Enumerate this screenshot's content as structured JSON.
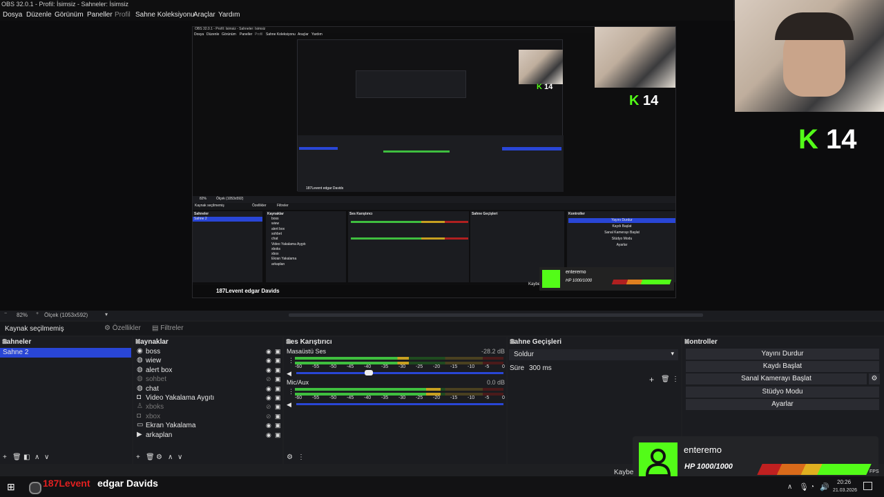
{
  "window": {
    "title": "OBS 32.0.1 - Profil: İsimsiz - Sahneler: İsimsiz"
  },
  "menu": [
    "Dosya",
    "Düzenle",
    "Görünüm",
    "Paneller",
    "Profil",
    "Sahne Koleksiyonu",
    "Araçlar",
    "Yardım"
  ],
  "nested_preview": {
    "title": "OBS 32.0.1 - Profil: İsimsiz - Sahneler: İsimsiz",
    "menu": [
      "Dosya",
      "Düzenle",
      "Görünüm",
      "Paneller",
      "Profil",
      "Sahne Koleksiyonu",
      "Araçlar",
      "Yardım"
    ],
    "status": "Kaynak seçilmemiş",
    "props": "Özellikler",
    "filters": "Filtreler",
    "zoom": "82%",
    "scale": "Ölçek (1053x592)",
    "scenes_title": "Sahneler",
    "scene": "Sahne 2",
    "sources_title": "Kaynaklar",
    "sources": [
      "boss",
      "wiew",
      "alert box",
      "sohbet",
      "chat",
      "Video Yakalama Aygıtı",
      "xboks",
      "xbox",
      "Ekran Yakalama",
      "arkaplan"
    ],
    "mixer_title": "Ses Karıştırıcı",
    "transitions_title": "Sahne Geçişleri",
    "controls_title": "Kontroller",
    "controls": [
      "Yayını Durdur",
      "Kaydı Başlat",
      "Sanal Kamerayı Başlat",
      "Stüdyo Modu",
      "Ayarlar"
    ],
    "bottom_text": "187Levent  edgar Davids",
    "kayb": "Kaybe",
    "k14": "14",
    "alert_name": "enteremo",
    "alert_hp": "HP 1000/1000"
  },
  "overlay": {
    "k14_label": "14",
    "alert_name": "enteremo",
    "alert_hp": "HP 1000/1000",
    "fps": "FPS",
    "kayb": "Kaybe"
  },
  "preview_bar": {
    "zoom": "82%",
    "scale": "Ölçek (1053x592)"
  },
  "props_bar": {
    "status": "Kaynak seçilmemiş",
    "properties": "Özellikler",
    "filters": "Filtreler"
  },
  "scenes": {
    "title": "Sahneler",
    "items": [
      "Sahne 2"
    ]
  },
  "sources": {
    "title": "Kaynaklar",
    "items": [
      {
        "name": "boss",
        "icon": "user-icon",
        "hidden": false
      },
      {
        "name": "wiew",
        "icon": "globe-icon",
        "hidden": false
      },
      {
        "name": "alert box",
        "icon": "globe-icon",
        "hidden": false
      },
      {
        "name": "sohbet",
        "icon": "globe-icon",
        "hidden": true
      },
      {
        "name": "chat",
        "icon": "globe-icon",
        "hidden": false
      },
      {
        "name": "Video Yakalama Aygıtı",
        "icon": "camera-icon",
        "hidden": false
      },
      {
        "name": "xboks",
        "icon": "person-icon",
        "hidden": true
      },
      {
        "name": "xbox",
        "icon": "camera-icon",
        "hidden": true
      },
      {
        "name": "Ekran Yakalama",
        "icon": "monitor-icon",
        "hidden": false
      },
      {
        "name": "arkaplan",
        "icon": "play-icon",
        "hidden": false
      }
    ]
  },
  "mixer": {
    "title": "Ses Karıştırıcı",
    "ticks": [
      "-60",
      "-55",
      "-50",
      "-45",
      "-40",
      "-35",
      "-30",
      "-25",
      "-20",
      "-15",
      "-10",
      "-5",
      "0"
    ],
    "channels": [
      {
        "name": "Masaüstü Ses",
        "db": "-28.2 dB",
        "level": 0.78
      },
      {
        "name": "Mic/Aux",
        "db": "0.0 dB",
        "level": 1.0
      }
    ]
  },
  "transitions": {
    "title": "Sahne Geçişleri",
    "selected": "Soldur",
    "duration_label": "Süre",
    "duration": "300 ms"
  },
  "controls": {
    "title": "Kontroller",
    "buttons": [
      "Yayını Durdur",
      "Kaydı Başlat",
      "Sanal Kamerayı Başlat",
      "Stüdyo Modu",
      "Ayarlar"
    ]
  },
  "bottom_overlay": {
    "user1": "187Levent",
    "user2": "edgar Davids"
  },
  "taskbar": {
    "time": "20:26",
    "date": "21.03.2026"
  },
  "colors": {
    "accent": "#2946d6",
    "kick_green": "#53fc18",
    "meter_green": "#3fbf3f",
    "meter_yellow": "#c8a020",
    "meter_red": "#b02020"
  }
}
